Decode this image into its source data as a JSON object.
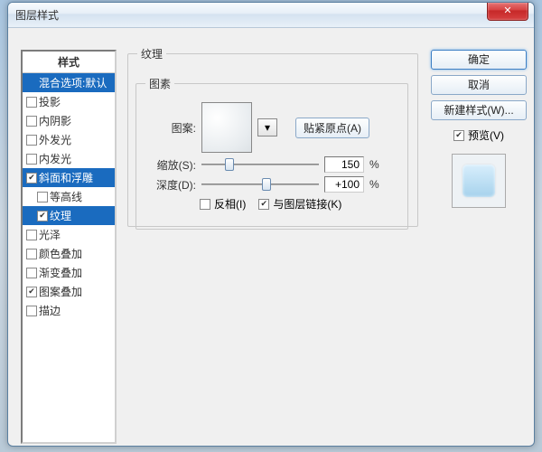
{
  "window": {
    "title": "图层样式"
  },
  "styles": {
    "header": "样式",
    "blend": "混合选项:默认",
    "items": [
      {
        "label": "投影",
        "checked": false
      },
      {
        "label": "内阴影",
        "checked": false
      },
      {
        "label": "外发光",
        "checked": false
      },
      {
        "label": "内发光",
        "checked": false
      },
      {
        "label": "斜面和浮雕",
        "checked": true,
        "selected": true
      },
      {
        "label": "等高线",
        "checked": false,
        "sub": true
      },
      {
        "label": "纹理",
        "checked": true,
        "sub": true,
        "selected": true
      },
      {
        "label": "光泽",
        "checked": false
      },
      {
        "label": "颜色叠加",
        "checked": false
      },
      {
        "label": "渐变叠加",
        "checked": false
      },
      {
        "label": "图案叠加",
        "checked": true
      },
      {
        "label": "描边",
        "checked": false
      }
    ]
  },
  "texture": {
    "legend": "纹理",
    "element_legend": "图素",
    "pattern_label": "图案:",
    "snap_btn": "贴紧原点(A)",
    "scale_label": "缩放(S):",
    "scale_value": "150",
    "scale_unit": "%",
    "depth_label": "深度(D):",
    "depth_value": "+100",
    "depth_unit": "%",
    "invert_label": "反相(I)",
    "invert_checked": false,
    "link_label": "与图层链接(K)",
    "link_checked": true
  },
  "buttons": {
    "ok": "确定",
    "cancel": "取消",
    "new_style": "新建样式(W)...",
    "preview": "预览(V)",
    "preview_checked": true
  }
}
